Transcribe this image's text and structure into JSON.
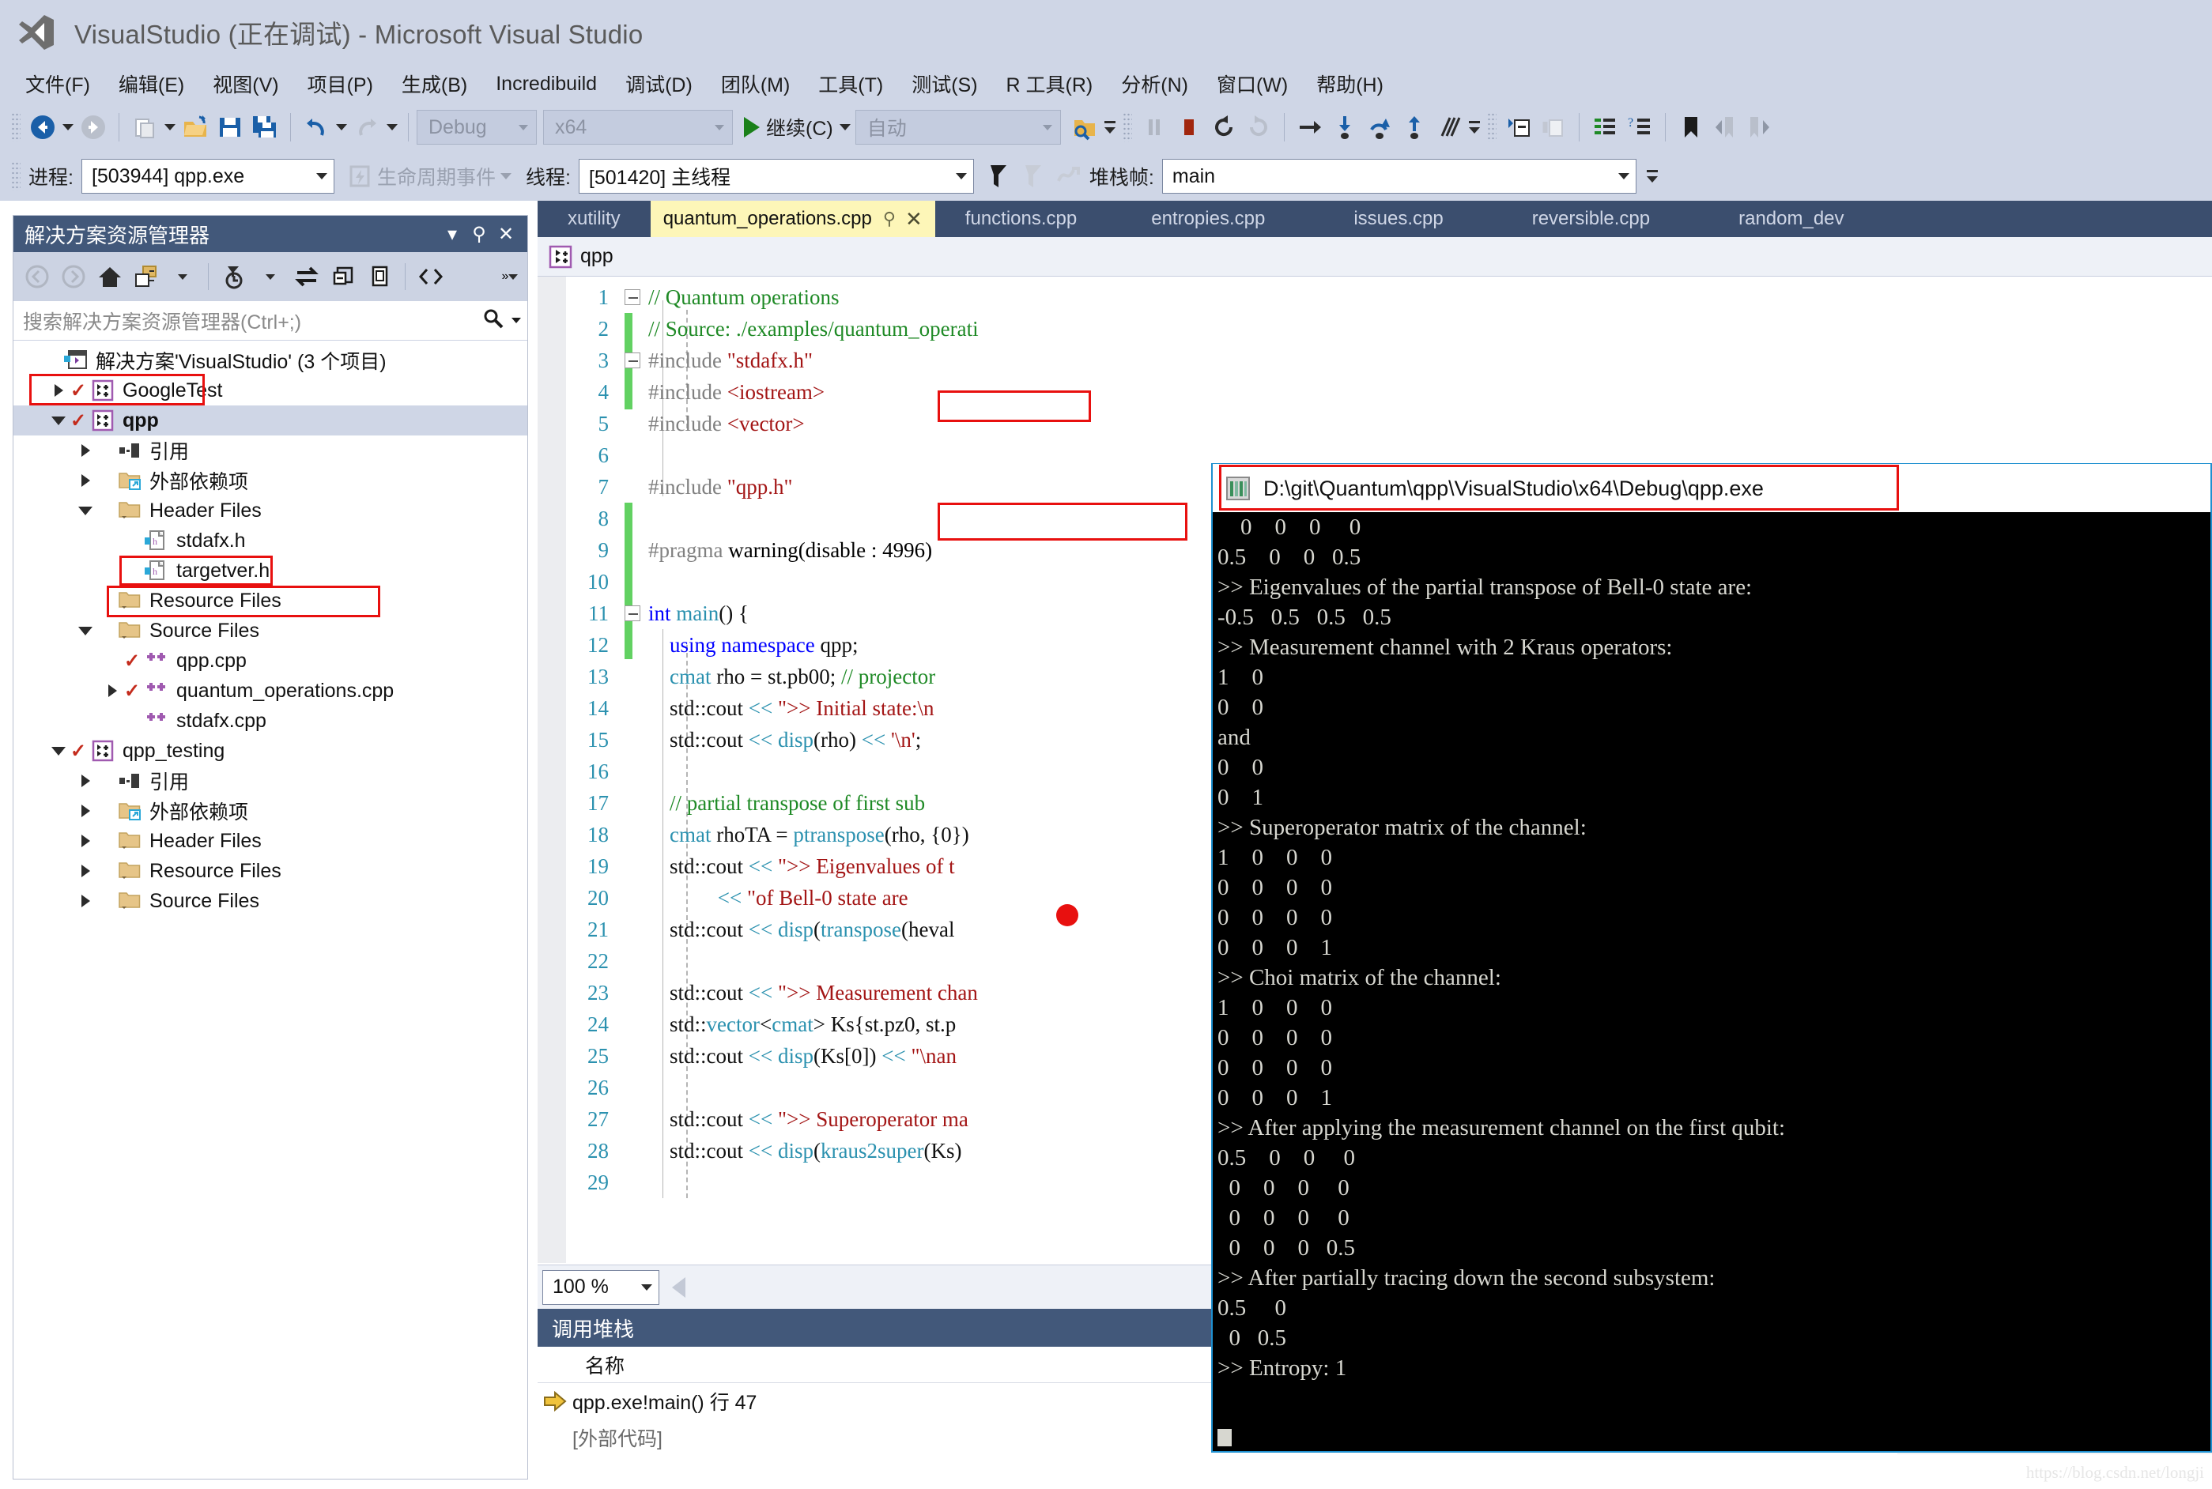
{
  "window": {
    "title": "VisualStudio (正在调试) - Microsoft Visual Studio",
    "logo_icon": "visual-studio-logo-icon"
  },
  "menubar": {
    "items": [
      {
        "label": "文件(F)"
      },
      {
        "label": "编辑(E)"
      },
      {
        "label": "视图(V)"
      },
      {
        "label": "项目(P)"
      },
      {
        "label": "生成(B)"
      },
      {
        "label": "Incredibuild"
      },
      {
        "label": "调试(D)"
      },
      {
        "label": "团队(M)"
      },
      {
        "label": "工具(T)"
      },
      {
        "label": "测试(S)"
      },
      {
        "label": "R 工具(R)"
      },
      {
        "label": "分析(N)"
      },
      {
        "label": "窗口(W)"
      },
      {
        "label": "帮助(H)"
      }
    ]
  },
  "toolbar": {
    "config_value": "Debug",
    "platform_value": "x64",
    "continue_label": "继续(C)",
    "attach_value": "自动"
  },
  "debugbar": {
    "process_label": "进程:",
    "process_value": "[503944] qpp.exe",
    "lifecycle_label": "生命周期事件",
    "thread_label": "线程:",
    "thread_value": "[501420] 主线程",
    "frame_label": "堆栈帧:",
    "frame_value": "main"
  },
  "solution_explorer": {
    "title": "解决方案资源管理器",
    "search_placeholder": "搜索解决方案资源管理器(Ctrl+;)",
    "tree": [
      {
        "indent": 0,
        "twisty": "none",
        "check": "",
        "icon": "solution-icon",
        "label": "解决方案'VisualStudio' (3 个项目)",
        "bold": false,
        "selected": false,
        "highlight": false
      },
      {
        "indent": 1,
        "twisty": "closed",
        "check": "✓",
        "icon": "cpp-project-icon",
        "label": "GoogleTest",
        "bold": false,
        "selected": false,
        "highlight": false
      },
      {
        "indent": 1,
        "twisty": "open",
        "check": "✓",
        "icon": "cpp-project-icon",
        "label": "qpp",
        "bold": true,
        "selected": true,
        "highlight": true
      },
      {
        "indent": 2,
        "twisty": "closed",
        "check": "",
        "icon": "references-icon",
        "label": "引用",
        "bold": false,
        "selected": false,
        "highlight": false
      },
      {
        "indent": 2,
        "twisty": "closed",
        "check": "",
        "icon": "ext-deps-icon",
        "label": "外部依赖项",
        "bold": false,
        "selected": false,
        "highlight": false
      },
      {
        "indent": 2,
        "twisty": "open",
        "check": "",
        "icon": "folder-icon",
        "label": "Header Files",
        "bold": false,
        "selected": false,
        "highlight": false
      },
      {
        "indent": 3,
        "twisty": "none",
        "check": "",
        "icon": "header-file-icon",
        "label": "stdafx.h",
        "bold": false,
        "selected": false,
        "highlight": false
      },
      {
        "indent": 3,
        "twisty": "none",
        "check": "",
        "icon": "header-file-icon",
        "label": "targetver.h",
        "bold": false,
        "selected": false,
        "highlight": false
      },
      {
        "indent": 2,
        "twisty": "none",
        "check": "",
        "icon": "folder-icon",
        "label": "Resource Files",
        "bold": false,
        "selected": false,
        "highlight": false
      },
      {
        "indent": 2,
        "twisty": "open",
        "check": "",
        "icon": "folder-icon",
        "label": "Source Files",
        "bold": false,
        "selected": false,
        "highlight": false
      },
      {
        "indent": 3,
        "twisty": "none",
        "check": "✓",
        "icon": "cpp-file-icon",
        "label": "qpp.cpp",
        "bold": false,
        "selected": false,
        "highlight": true
      },
      {
        "indent": 3,
        "twisty": "closed",
        "check": "✓",
        "icon": "cpp-file-icon",
        "label": "quantum_operations.cpp",
        "bold": false,
        "selected": false,
        "highlight": true
      },
      {
        "indent": 3,
        "twisty": "none",
        "check": "",
        "icon": "cpp-file-icon",
        "label": "stdafx.cpp",
        "bold": false,
        "selected": false,
        "highlight": false
      },
      {
        "indent": 1,
        "twisty": "open",
        "check": "✓",
        "icon": "cpp-project-icon",
        "label": "qpp_testing",
        "bold": false,
        "selected": false,
        "highlight": false
      },
      {
        "indent": 2,
        "twisty": "closed",
        "check": "",
        "icon": "references-icon",
        "label": "引用",
        "bold": false,
        "selected": false,
        "highlight": false
      },
      {
        "indent": 2,
        "twisty": "closed",
        "check": "",
        "icon": "ext-deps-icon",
        "label": "外部依赖项",
        "bold": false,
        "selected": false,
        "highlight": false
      },
      {
        "indent": 2,
        "twisty": "closed",
        "check": "",
        "icon": "folder-icon",
        "label": "Header Files",
        "bold": false,
        "selected": false,
        "highlight": false
      },
      {
        "indent": 2,
        "twisty": "closed",
        "check": "",
        "icon": "folder-icon",
        "label": "Resource Files",
        "bold": false,
        "selected": false,
        "highlight": false
      },
      {
        "indent": 2,
        "twisty": "closed",
        "check": "",
        "icon": "folder-icon",
        "label": "Source Files",
        "bold": false,
        "selected": false,
        "highlight": false
      }
    ]
  },
  "editor": {
    "tabs": [
      {
        "label": "xutility",
        "active": false
      },
      {
        "label": "quantum_operations.cpp",
        "active": true
      },
      {
        "label": "functions.cpp",
        "active": false
      },
      {
        "label": "entropies.cpp",
        "active": false
      },
      {
        "label": "issues.cpp",
        "active": false
      },
      {
        "label": "reversible.cpp",
        "active": false
      },
      {
        "label": "random_dev",
        "active": false
      }
    ],
    "project_context": "qpp",
    "zoom_level": "100 %",
    "lines": [
      {
        "n": "1",
        "fold": "open",
        "text": "// Quantum operations",
        "cls": "c-com"
      },
      {
        "n": "2",
        "fold": "none",
        "text": "// Source: ./examples/quantum_operati",
        "cls": "c-com"
      },
      {
        "n": "3",
        "fold": "open",
        "text": "#include \"stdafx.h\"",
        "cls": "mixed-include"
      },
      {
        "n": "4",
        "fold": "none",
        "text": "#include <iostream>",
        "cls": "mixed-include"
      },
      {
        "n": "5",
        "fold": "none",
        "text": "#include <vector>",
        "cls": "mixed-include"
      },
      {
        "n": "6",
        "fold": "none",
        "text": "",
        "cls": ""
      },
      {
        "n": "7",
        "fold": "none",
        "text": "#include \"qpp.h\"",
        "cls": "mixed-include"
      },
      {
        "n": "8",
        "fold": "none",
        "text": "",
        "cls": ""
      },
      {
        "n": "9",
        "fold": "none",
        "text": "#pragma warning(disable : 4996)",
        "cls": "c-pre"
      },
      {
        "n": "10",
        "fold": "none",
        "text": "",
        "cls": ""
      },
      {
        "n": "11",
        "fold": "open",
        "text": "int main() {",
        "cls": "mixed-main"
      },
      {
        "n": "12",
        "fold": "none",
        "text": "    using namespace qpp;",
        "cls": "mixed-using"
      },
      {
        "n": "13",
        "fold": "none",
        "text": "    cmat rho = st.pb00; // projector ",
        "cls": "mixed-13"
      },
      {
        "n": "14",
        "fold": "none",
        "text": "    std::cout << \">> Initial state:\\n",
        "cls": "mixed-14"
      },
      {
        "n": "15",
        "fold": "none",
        "text": "    std::cout << disp(rho) << '\\n';",
        "cls": "mixed-15"
      },
      {
        "n": "16",
        "fold": "none",
        "text": "",
        "cls": ""
      },
      {
        "n": "17",
        "fold": "none",
        "text": "    // partial transpose of first sub",
        "cls": "c-com"
      },
      {
        "n": "18",
        "fold": "none",
        "text": "    cmat rhoTA = ptranspose(rho, {0})",
        "cls": "mixed-18"
      },
      {
        "n": "19",
        "fold": "none",
        "text": "    std::cout << \">> Eigenvalues of t",
        "cls": "mixed-19"
      },
      {
        "n": "20",
        "fold": "none",
        "text": "             << \"of Bell-0 state are",
        "cls": "mixed-20"
      },
      {
        "n": "21",
        "fold": "none",
        "text": "    std::cout << disp(transpose(heval",
        "cls": "mixed-21"
      },
      {
        "n": "22",
        "fold": "none",
        "text": "",
        "cls": ""
      },
      {
        "n": "23",
        "fold": "none",
        "text": "    std::cout << \">> Measurement chan",
        "cls": "mixed-23"
      },
      {
        "n": "24",
        "fold": "none",
        "text": "    std::vector<cmat> Ks{st.pz0, st.p",
        "cls": "mixed-24"
      },
      {
        "n": "25",
        "fold": "none",
        "text": "    std::cout << disp(Ks[0]) << \"\\nan",
        "cls": "mixed-25"
      },
      {
        "n": "26",
        "fold": "none",
        "text": "",
        "cls": ""
      },
      {
        "n": "27",
        "fold": "none",
        "text": "    std::cout << \">> Superoperator ma",
        "cls": "mixed-27"
      },
      {
        "n": "28",
        "fold": "none",
        "text": "    std::cout << disp(kraus2super(Ks)",
        "cls": "mixed-28"
      },
      {
        "n": "29",
        "fold": "none",
        "text": "",
        "cls": ""
      }
    ]
  },
  "callstack": {
    "title": "调用堆栈",
    "column_name": "名称",
    "rows": [
      {
        "current": true,
        "label": "qpp.exe!main() 行 47"
      },
      {
        "current": false,
        "label": "[外部代码]"
      }
    ]
  },
  "console": {
    "title": "D:\\git\\Quantum\\qpp\\VisualStudio\\x64\\Debug\\qpp.exe",
    "icon": "console-window-icon",
    "output": "    0    0    0     0\n0.5    0    0   0.5\n>> Eigenvalues of the partial transpose of Bell-0 state are:\n-0.5   0.5   0.5   0.5\n>> Measurement channel with 2 Kraus operators:\n1    0\n0    0\nand\n0    0\n0    1\n>> Superoperator matrix of the channel:\n1    0    0    0\n0    0    0    0\n0    0    0    0\n0    0    0    1\n>> Choi matrix of the channel:\n1    0    0    0\n0    0    0    0\n0    0    0    0\n0    0    0    1\n>> After applying the measurement channel on the first qubit:\n0.5    0    0     0\n  0    0    0     0\n  0    0    0     0\n  0    0    0   0.5\n>> After partially tracing down the second subsystem:\n0.5     0\n  0   0.5\n>> Entropy: 1"
  },
  "watermark": {
    "text": "https://blog.csdn.net/longji"
  },
  "colors": {
    "chrome": "#cfd6e6",
    "panel_title": "#42587a",
    "tab_active": "#fdf6b8",
    "tabstrip": "#3b4e6e",
    "accent_red": "#e8100f",
    "console_border": "#1e90d0",
    "comment_green": "#1f8a26",
    "string_red": "#a31515",
    "keyword_blue": "#0000ff",
    "type_teal": "#2b91af"
  }
}
